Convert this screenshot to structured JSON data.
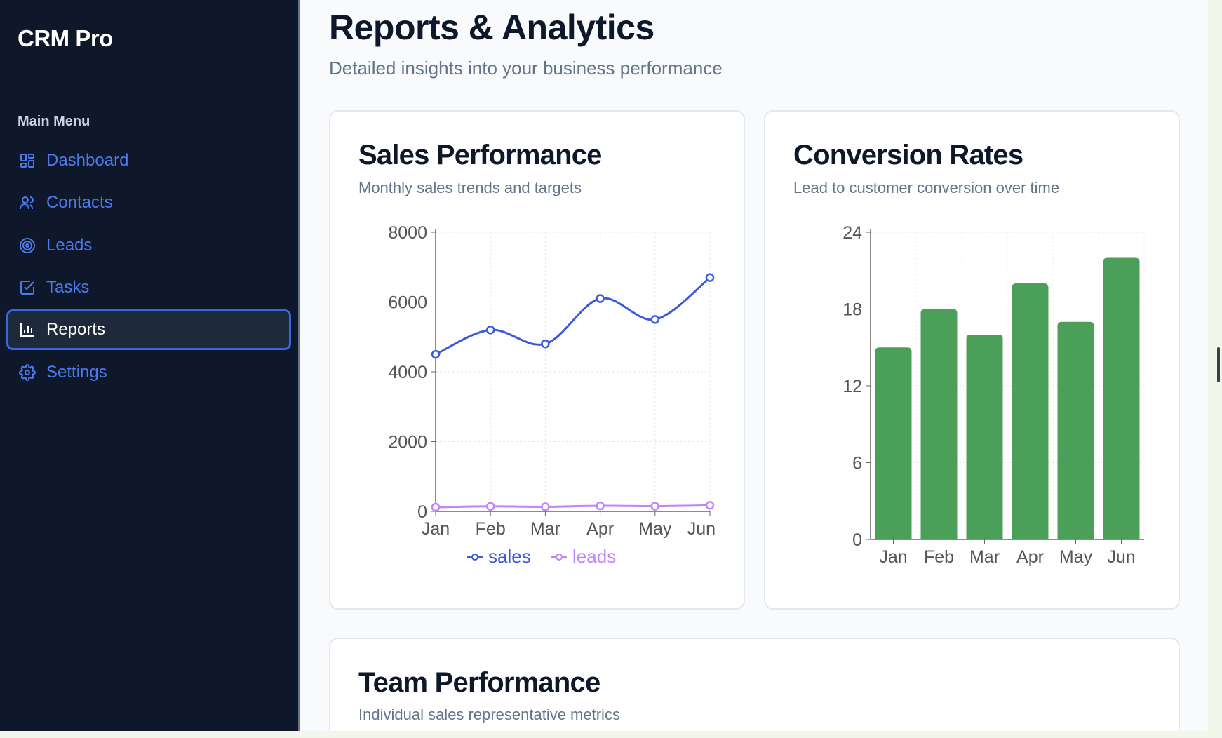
{
  "app": {
    "brand": "CRM Pro"
  },
  "sidebar": {
    "menu_title": "Main Menu",
    "items": [
      {
        "label": "Dashboard",
        "icon": "grid-icon",
        "active": false
      },
      {
        "label": "Contacts",
        "icon": "users-icon",
        "active": false
      },
      {
        "label": "Leads",
        "icon": "target-icon",
        "active": false
      },
      {
        "label": "Tasks",
        "icon": "checkbox-icon",
        "active": false
      },
      {
        "label": "Reports",
        "icon": "bar-chart-icon",
        "active": true
      },
      {
        "label": "Settings",
        "icon": "gear-icon",
        "active": false
      }
    ]
  },
  "main": {
    "title": "Reports & Analytics",
    "subtitle": "Detailed insights into your business performance",
    "cards": {
      "sales": {
        "title": "Sales Performance",
        "subtitle": "Monthly sales trends and targets"
      },
      "conversion": {
        "title": "Conversion Rates",
        "subtitle": "Lead to customer conversion over time"
      },
      "team": {
        "title": "Team Performance",
        "subtitle": "Individual sales representative metrics"
      }
    }
  },
  "colors": {
    "sales": "#3b5bdb",
    "leads": "#c084fc",
    "conversion": "#4c9f58",
    "accent": "#3b64e0"
  },
  "chart_data": [
    {
      "type": "line",
      "categories": [
        "Jan",
        "Feb",
        "Mar",
        "Apr",
        "May",
        "Jun"
      ],
      "series": [
        {
          "name": "sales",
          "values": [
            4500,
            5200,
            4800,
            6100,
            5500,
            6700
          ]
        },
        {
          "name": "leads",
          "values": [
            120,
            145,
            132,
            160,
            150,
            175
          ]
        }
      ],
      "ylim": [
        0,
        8000
      ],
      "yticks": [
        0,
        2000,
        4000,
        6000,
        8000
      ],
      "grid": true,
      "legend": "bottom"
    },
    {
      "type": "bar",
      "categories": [
        "Jan",
        "Feb",
        "Mar",
        "Apr",
        "May",
        "Jun"
      ],
      "values": [
        15,
        18,
        16,
        20,
        17,
        22
      ],
      "ylim": [
        0,
        24
      ],
      "yticks": [
        0,
        6,
        12,
        18,
        24
      ],
      "grid": true
    }
  ]
}
